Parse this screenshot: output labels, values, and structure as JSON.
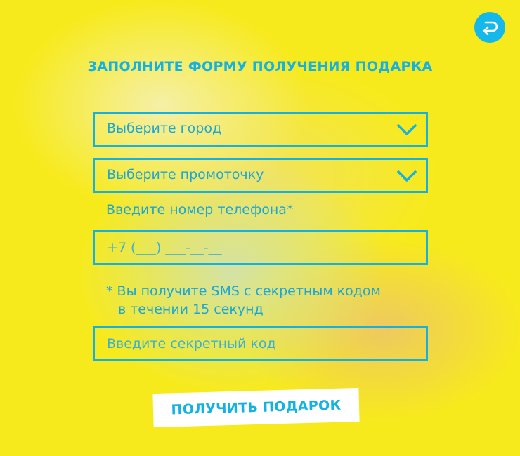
{
  "header": {
    "back_icon": "back-arrow-icon",
    "title": "ЗАПОЛНИТЕ ФОРМУ ПОЛУЧЕНИЯ ПОДАРКА"
  },
  "form": {
    "city_select": {
      "value": "Выберите город",
      "icon": "chevron-down-icon"
    },
    "promo_select": {
      "value": "Выберите промоточку",
      "icon": "chevron-down-icon"
    },
    "phone_label": "Введите номер телефона*",
    "phone_input": {
      "placeholder": "+7 (___) ___-__-__"
    },
    "sms_note_line1": "* Вы получите SMS с секретным кодом",
    "sms_note_line2": "в течении 15 секунд",
    "code_input": {
      "placeholder": "Введите секретный код"
    },
    "submit_label": "ПОЛУЧИТЬ ПОДАРОК"
  },
  "colors": {
    "background": "#f7ea1c",
    "accent": "#14b2e3",
    "button_bg": "#ffffff"
  }
}
